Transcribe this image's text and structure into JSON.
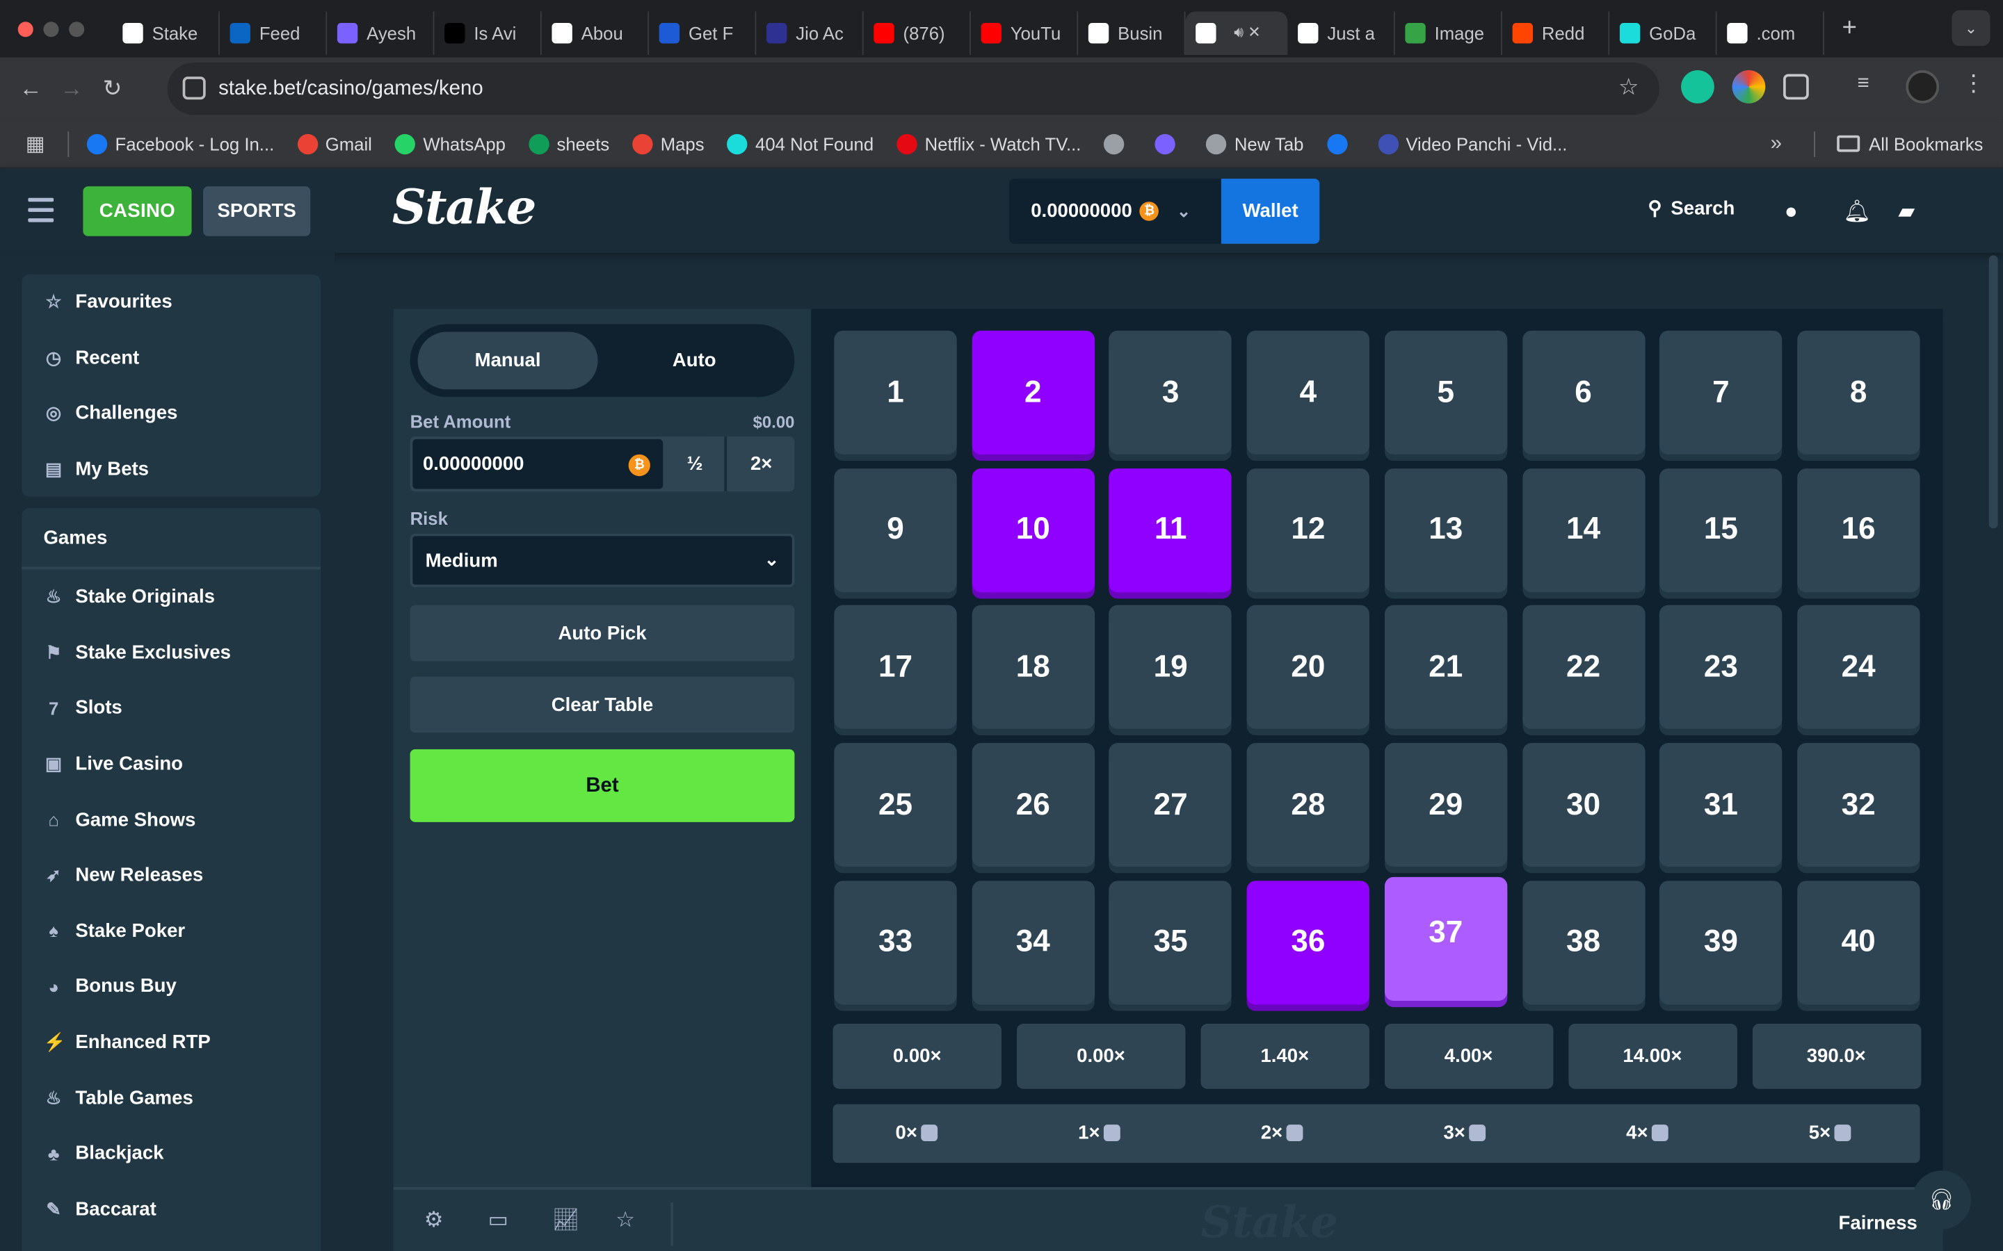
{
  "browser": {
    "tabs": [
      "Stake",
      "Feed",
      "Ayesh",
      "Is Avi",
      "Abou",
      "Get F",
      "Jio Ac",
      "(876)",
      "YouTu",
      "Busin",
      "",
      "Just a",
      "Image",
      "Redd",
      "GoDa",
      ".com"
    ],
    "tab_colors": [
      "#ffffff",
      "#0a66c2",
      "#7b61ff",
      "#000000",
      "#ffffff",
      "#1d5bd6",
      "#2e3192",
      "#ff0000",
      "#ff0000",
      "#ffffff",
      "#ffffff",
      "#ffffff",
      "#37a347",
      "#ff4500",
      "#1bdbdb",
      "#ffffff"
    ],
    "url": "stake.bet/casino/games/keno",
    "bookmarks": [
      "Facebook - Log In...",
      "Gmail",
      "WhatsApp",
      "sheets",
      "Maps",
      "404 Not Found",
      "Netflix - Watch TV...",
      "",
      "",
      "New Tab",
      "",
      "Video Panchi - Vid..."
    ],
    "bookmark_colors": [
      "#1877f2",
      "#ea4335",
      "#25d366",
      "#0f9d58",
      "#ea4335",
      "#1bdbdb",
      "#e50914",
      "#9aa0a6",
      "#7b61ff",
      "#9aa0a6",
      "#1877f2",
      "#3f51b5"
    ],
    "all_bookmarks": "All Bookmarks"
  },
  "header": {
    "casino": "CASINO",
    "sports": "SPORTS",
    "logo": "Stake",
    "balance": "0.00000000",
    "wallet": "Wallet",
    "search": "Search"
  },
  "sidebar": {
    "top_items": [
      {
        "label": "Favourites",
        "icon": "☆"
      },
      {
        "label": "Recent",
        "icon": "◷"
      },
      {
        "label": "Challenges",
        "icon": "◎"
      },
      {
        "label": "My Bets",
        "icon": "▤"
      }
    ],
    "games_header": "Games",
    "game_items": [
      {
        "label": "Stake Originals",
        "icon": "♨"
      },
      {
        "label": "Stake Exclusives",
        "icon": "⚑"
      },
      {
        "label": "Slots",
        "icon": "7"
      },
      {
        "label": "Live Casino",
        "icon": "▣"
      },
      {
        "label": "Game Shows",
        "icon": "⌂"
      },
      {
        "label": "New Releases",
        "icon": "➶"
      },
      {
        "label": "Stake Poker",
        "icon": "♠"
      },
      {
        "label": "Bonus Buy",
        "icon": "◕"
      },
      {
        "label": "Enhanced RTP",
        "icon": "⚡"
      },
      {
        "label": "Table Games",
        "icon": "♨"
      },
      {
        "label": "Blackjack",
        "icon": "♣"
      },
      {
        "label": "Baccarat",
        "icon": "✎"
      }
    ]
  },
  "controls": {
    "mode_manual": "Manual",
    "mode_auto": "Auto",
    "bet_amount_label": "Bet Amount",
    "bet_amount_usd": "$0.00",
    "bet_amount": "0.00000000",
    "half": "½",
    "double": "2×",
    "risk_label": "Risk",
    "risk_value": "Medium",
    "auto_pick": "Auto Pick",
    "clear_table": "Clear Table",
    "bet": "Bet"
  },
  "board": {
    "numbers": [
      "1",
      "2",
      "3",
      "4",
      "5",
      "6",
      "7",
      "8",
      "9",
      "10",
      "11",
      "12",
      "13",
      "14",
      "15",
      "16",
      "17",
      "18",
      "19",
      "20",
      "21",
      "22",
      "23",
      "24",
      "25",
      "26",
      "27",
      "28",
      "29",
      "30",
      "31",
      "32",
      "33",
      "34",
      "35",
      "36",
      "37",
      "38",
      "39",
      "40"
    ],
    "selected": [
      2,
      10,
      11,
      36
    ],
    "hovered": [
      37
    ],
    "multipliers": [
      "0.00×",
      "0.00×",
      "1.40×",
      "4.00×",
      "14.00×",
      "390.0×"
    ],
    "hits": [
      "0×",
      "1×",
      "2×",
      "3×",
      "4×",
      "5×"
    ]
  },
  "footer": {
    "fairness": "Fairness",
    "watermark": "Stake"
  },
  "colors": {
    "selected_tile": "#9000ff",
    "hover_tile": "#ad5cff",
    "bet_button": "#64e643",
    "wallet_button": "#1475e1"
  }
}
